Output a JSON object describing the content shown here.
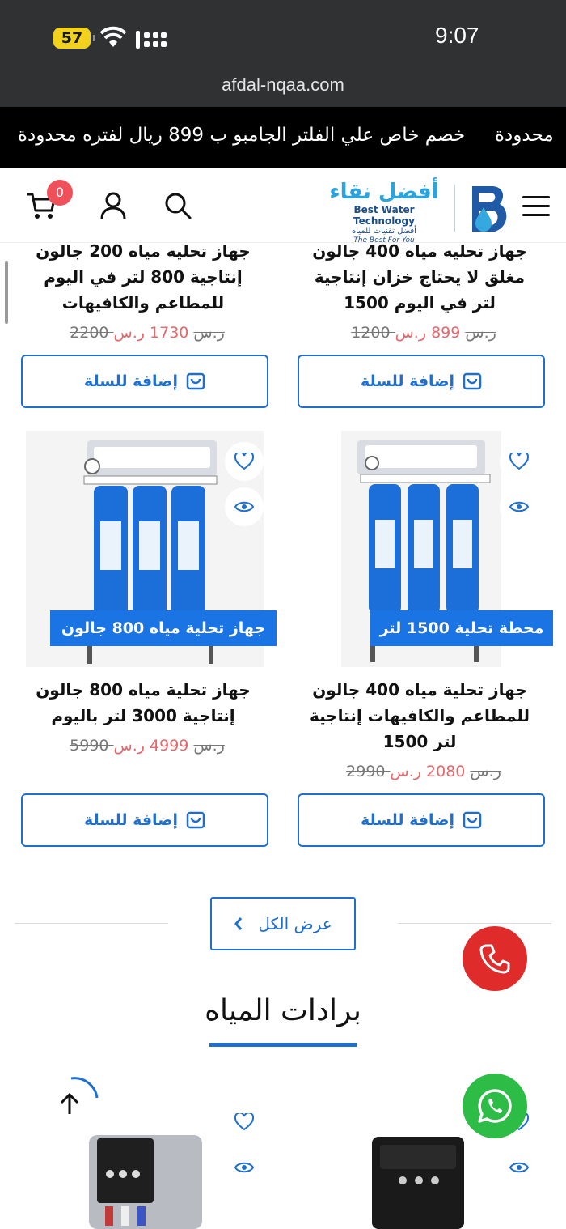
{
  "status_bar": {
    "battery": "57",
    "time": "9:07"
  },
  "browser": {
    "url": "afdal-nqaa.com"
  },
  "ticker": {
    "messages": [
      "محدودة",
      "خصم خاص علي الفلتر الجامبو ب 899 ريال لفتره محدودة"
    ]
  },
  "header": {
    "logo": {
      "arabic": "أفضل نقاء",
      "english": "Best Water Technology",
      "arabic_sub": "أفضل تقنيات للمياه",
      "tagline": "The Best For You"
    },
    "cart_count": "0"
  },
  "products": [
    {
      "title_lines": [
        "جهاز تحليه مياه 400 جالون",
        "مغلق لا يحتاج خزان إنتاجية",
        "1500 لتر في اليوم"
      ],
      "price": "899",
      "old_price": "1200",
      "currency": "ر.س",
      "add_to_cart": "إضافة للسلة"
    },
    {
      "title_lines": [
        "جهاز تحليه مياه 200 جالون",
        "إنتاجية 800 لتر في اليوم",
        "للمطاعم والكافيهات"
      ],
      "price": "1730",
      "old_price": "2200",
      "currency": "ر.س",
      "add_to_cart": "إضافة للسلة"
    },
    {
      "label": "محطة تحلية 1500 لتر",
      "title_lines": [
        "جهاز تحلية مياه 400 جالون",
        "للمطاعم والكافيهات إنتاجية",
        "1500 لتر"
      ],
      "price": "2080",
      "old_price": "2990",
      "currency": "ر.س",
      "add_to_cart": "إضافة للسلة"
    },
    {
      "label": "جهاز تحلية مياه 800 جالون",
      "title_lines": [
        "جهاز تحلية مياه 800 جالون",
        "إنتاجية 3000 لتر باليوم"
      ],
      "price": "4999",
      "old_price": "5990",
      "currency": "ر.س",
      "add_to_cart": "إضافة للسلة"
    }
  ],
  "view_all": "عرض الكل",
  "section_title": "برادات المياه",
  "colors": {
    "accent": "#1f6fd1",
    "label_bg": "#1b74e4",
    "price": "#e8676b",
    "call": "#e02b2b",
    "whatsapp": "#2dbc45"
  },
  "icons": [
    "hamburger-icon",
    "search-icon",
    "user-icon",
    "cart-icon",
    "heart-icon",
    "eye-icon",
    "phone-icon",
    "whatsapp-icon",
    "arrow-up-icon",
    "chevron-left-icon"
  ]
}
